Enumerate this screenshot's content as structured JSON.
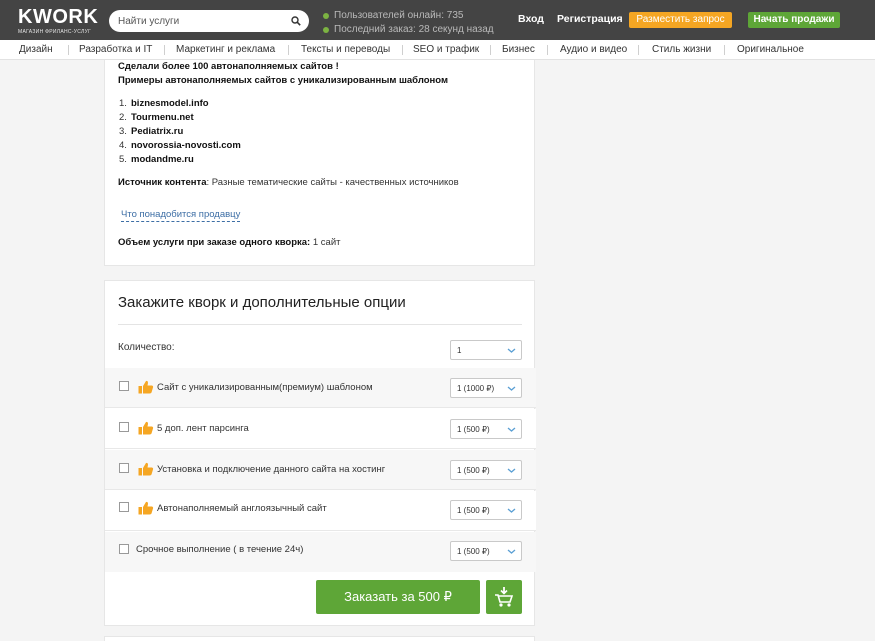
{
  "header": {
    "logo_text": "KWORK",
    "logo_tagline": "МАГАЗИН ФРИЛАНС-УСЛУГ",
    "search_placeholder": "Найти услуги",
    "online_users": "Пользователей онлайн: 735",
    "last_order": "Последний заказ: 28 секунд назад",
    "login_label": "Вход",
    "register_label": "Регистрация",
    "post_request_label": "Разместить запрос",
    "start_selling_label": "Начать продажи"
  },
  "categories": [
    "Дизайн",
    "Разработка и IT",
    "Маркетинг и реклама",
    "Тексты и переводы",
    "SEO и трафик",
    "Бизнес",
    "Аудио и видео",
    "Стиль жизни",
    "Оригинальное"
  ],
  "description": {
    "line1": "Сделали более 100 автонаполняемых сайтов !",
    "line2": "Примеры автонаполняемых сайтов с уникализированным шаблоном",
    "sites": [
      "biznesmodel.info",
      "Tourmenu.net",
      "Pediatrix.ru",
      "novorossia-novosti.com",
      "modandme.ru"
    ],
    "source_label": "Источник контента",
    "source_value": ": Разные тематические сайты - качественных источников",
    "seller_needs_link": "Что понадобится продавцу",
    "volume_label": "Объем услуги при заказе одного кворка:",
    "volume_value": " 1 сайт"
  },
  "order": {
    "title": "Закажите кворк и дополнительные опции",
    "quantity_label": "Количество:",
    "quantity_value": "1",
    "options": [
      {
        "label": "Сайт с уникализированным(премиум) шаблоном",
        "price": "1 (1000 ₽)",
        "thumb": true
      },
      {
        "label": "5 доп. лент парсинга",
        "price": "1 (500 ₽)",
        "thumb": true
      },
      {
        "label": "Установка и подключение данного сайта на хостинг",
        "price": "1 (500 ₽)",
        "thumb": true
      },
      {
        "label": "Автонаполняемый англоязычный сайт",
        "price": "1 (500 ₽)",
        "thumb": true
      },
      {
        "label": "Срочное выполнение ( в течение 24ч)",
        "price": "1 (500 ₽)",
        "thumb": false
      }
    ],
    "order_button": "Заказать за 500 ₽"
  },
  "colors": {
    "header_bg": "#444444",
    "accent_green": "#5ea637",
    "accent_orange": "#f5a623",
    "link_blue": "#3d6ea5",
    "thumb_orange": "#f5a623"
  },
  "icons": [
    "search-icon",
    "online-dot-icon",
    "thumbs-up-icon",
    "chevron-down-icon",
    "add-to-cart-icon"
  ]
}
